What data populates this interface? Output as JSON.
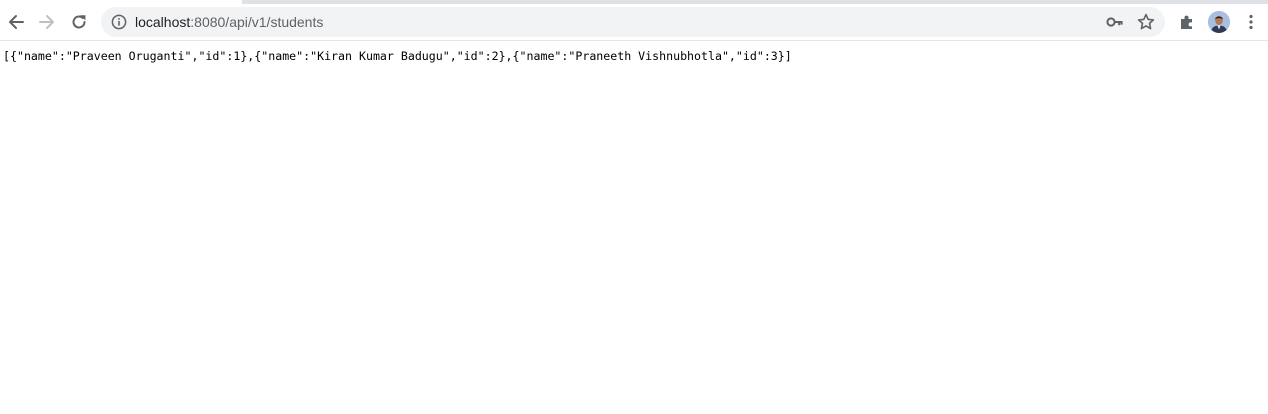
{
  "browser": {
    "url_host": "localhost",
    "url_path": ":8080/api/v1/students",
    "icons": {
      "back": "back-arrow-icon",
      "forward": "forward-arrow-icon",
      "reload": "reload-icon",
      "site_info": "info-icon",
      "passwords": "key-icon",
      "bookmark": "star-icon",
      "extensions": "puzzle-icon",
      "profile": "avatar",
      "menu": "kebab-menu-icon"
    }
  },
  "page": {
    "json_text": "[{\"name\":\"Praveen Oruganti\",\"id\":1},{\"name\":\"Kiran Kumar Badugu\",\"id\":2},{\"name\":\"Praneeth Vishnubhotla\",\"id\":3}]"
  }
}
